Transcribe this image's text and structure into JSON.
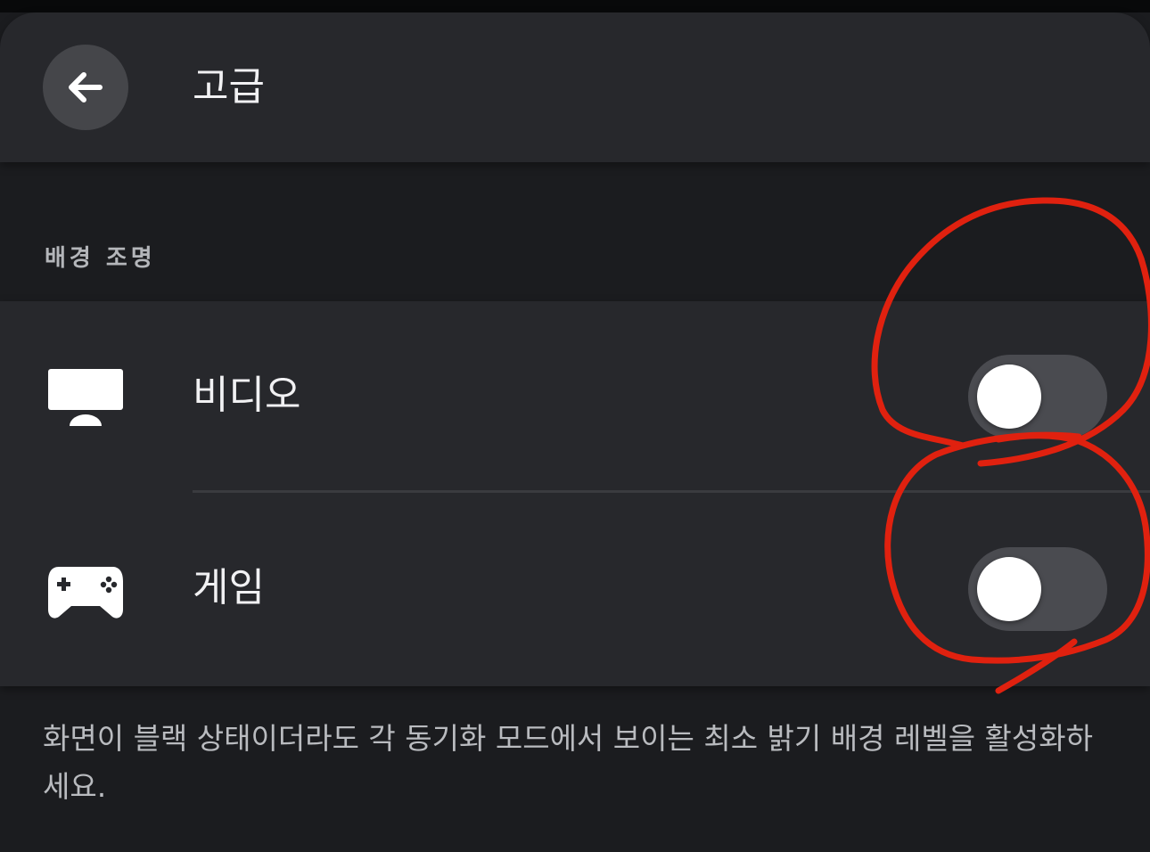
{
  "header": {
    "title": "고급",
    "back_icon": "arrow-left-icon"
  },
  "section": {
    "label": "배경 조명"
  },
  "settings": [
    {
      "label": "비디오",
      "icon": "monitor-icon",
      "enabled": false
    },
    {
      "label": "게임",
      "icon": "gamepad-icon",
      "enabled": false
    }
  ],
  "description": "화면이 블랙 상태이더라도 각 동기화 모드에서 보이는 최소 밝기 배경 레벨을 활성화하세요.",
  "colors": {
    "background": "#1b1c1f",
    "surface": "#27282c",
    "toggle_track_off": "#4a4b50",
    "toggle_knob": "#ffffff",
    "annotation_stroke": "#e0210f"
  }
}
